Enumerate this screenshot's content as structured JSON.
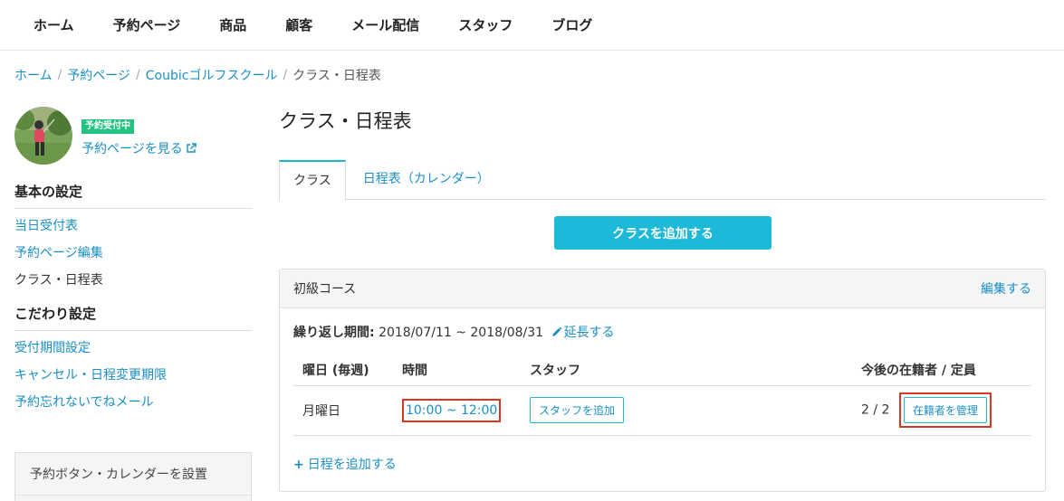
{
  "nav": {
    "items": [
      "ホーム",
      "予約ページ",
      "商品",
      "顧客",
      "メール配信",
      "スタッフ",
      "ブログ"
    ]
  },
  "breadcrumb": {
    "items": [
      "ホーム",
      "予約ページ",
      "Coubicゴルフスクール"
    ],
    "current": "クラス・日程表"
  },
  "sidebar": {
    "badge": "予約受付中",
    "view_page": "予約ページを見る",
    "basic_title": "基本の設定",
    "basic_items": [
      "当日受付表",
      "予約ページ編集",
      "クラス・日程表"
    ],
    "advanced_title": "こだわり設定",
    "advanced_items": [
      "受付期間設定",
      "キャンセル・日程変更期限",
      "予約忘れないでねメール"
    ],
    "box_title": "予約ボタン・カレンダーを設置"
  },
  "main": {
    "title": "クラス・日程表",
    "tabs": [
      "クラス",
      "日程表（カレンダー）"
    ],
    "add_class": "クラスを追加する",
    "panel": {
      "name": "初級コース",
      "edit": "編集する",
      "repeat_label": "繰り返し期間:",
      "repeat_value": "2018/07/11 ~ 2018/08/31",
      "extend": "延長する",
      "headers": [
        "曜日 (毎週)",
        "時間",
        "スタッフ",
        "今後の在籍者 / 定員"
      ],
      "row": {
        "day": "月曜日",
        "time": "10:00 ~ 12:00",
        "staff_btn": "スタッフを追加",
        "enrollment": "2 / 2",
        "manage_btn": "在籍者を管理"
      },
      "add_schedule": "日程を追加する"
    }
  },
  "colors": {
    "accent": "#1cb9d9",
    "link": "#1a8fc6",
    "badge": "#25c183",
    "highlight": "#d6391f"
  }
}
